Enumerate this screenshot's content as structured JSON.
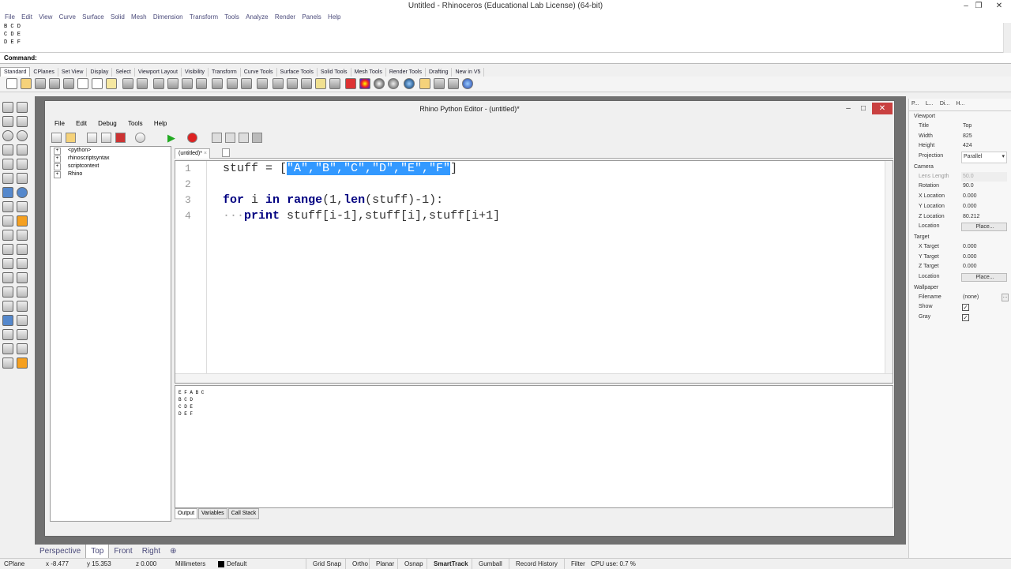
{
  "app": {
    "title": "Untitled - Rhinoceros (Educational Lab License) (64-bit)"
  },
  "menu": [
    "File",
    "Edit",
    "View",
    "Curve",
    "Surface",
    "Solid",
    "Mesh",
    "Dimension",
    "Transform",
    "Tools",
    "Analyze",
    "Render",
    "Panels",
    "Help"
  ],
  "history": [
    "B C D",
    "C D E",
    "D E F"
  ],
  "command": {
    "label": "Command:"
  },
  "toolbar_tabs": [
    "Standard",
    "CPlanes",
    "Set View",
    "Display",
    "Select",
    "Viewport Layout",
    "Visibility",
    "Transform",
    "Curve Tools",
    "Surface Tools",
    "Solid Tools",
    "Mesh Tools",
    "Render Tools",
    "Drafting",
    "New in V5"
  ],
  "editor": {
    "title": "Rhino Python Editor - (untitled)*",
    "menu": [
      "File",
      "Edit",
      "Debug",
      "Tools",
      "Help"
    ],
    "tree": [
      "<python>",
      "rhinoscriptsyntax",
      "scriptcontext",
      "Rhino"
    ],
    "doc_tab": "(untitled)*",
    "line_numbers": [
      "1",
      "2",
      "3",
      "4"
    ],
    "code": {
      "l1_pre": "stuff = [",
      "l1_sel": "\"A\",\"B\",\"C\",\"D\",\"E\",\"F\"",
      "l1_post": "]",
      "l3_kw1": "for",
      "l3_a": " i ",
      "l3_kw2": "in",
      "l3_b": " ",
      "l3_kw3": "range",
      "l3_c": "(1,",
      "l3_kw4": "len",
      "l3_d": "(stuff)-1):",
      "l4_dots": "···",
      "l4_kw": "print",
      "l4_rest": " stuff[i-1],stuff[i],stuff[i+1]"
    },
    "output": [
      "E F A B C",
      "B C D",
      "C D E",
      "D E F"
    ],
    "output_tabs": [
      "Output",
      "Variables",
      "Call Stack"
    ]
  },
  "properties": {
    "tabs": [
      "P...",
      "L...",
      "Di...",
      "H..."
    ],
    "viewport_label": "Viewport",
    "title_label": "Title",
    "title_value": "Top",
    "width_label": "Width",
    "width_value": "825",
    "height_label": "Height",
    "height_value": "424",
    "projection_label": "Projection",
    "projection_value": "Parallel",
    "camera_label": "Camera",
    "lens_label": "Lens Length",
    "lens_value": "50.0",
    "rotation_label": "Rotation",
    "rotation_value": "90.0",
    "xloc_label": "X Location",
    "xloc_value": "0.000",
    "yloc_label": "Y Location",
    "yloc_value": "0.000",
    "zloc_label": "Z Location",
    "zloc_value": "80.212",
    "location_label": "Location",
    "place_button": "Place...",
    "target_label": "Target",
    "xt_label": "X Target",
    "xt_value": "0.000",
    "yt_label": "Y Target",
    "yt_value": "0.000",
    "zt_label": "Z Target",
    "zt_value": "0.000",
    "tlocation_label": "Location",
    "tplace_button": "Place...",
    "wallpaper_label": "Wallpaper",
    "filename_label": "Filename",
    "filename_value": "(none)",
    "show_label": "Show",
    "gray_label": "Gray"
  },
  "viewtabs": [
    "Perspective",
    "Top",
    "Front",
    "Right"
  ],
  "status": {
    "cplane": "CPlane",
    "x": "x -8.477",
    "y": "y 15.353",
    "z": "z 0.000",
    "units": "Millimeters",
    "layer": "Default",
    "items": [
      "Grid Snap",
      "Ortho",
      "Planar",
      "Osnap",
      "SmartTrack",
      "Gumball",
      "Record History",
      "Filter",
      "CPU use: 0.7 %"
    ]
  }
}
